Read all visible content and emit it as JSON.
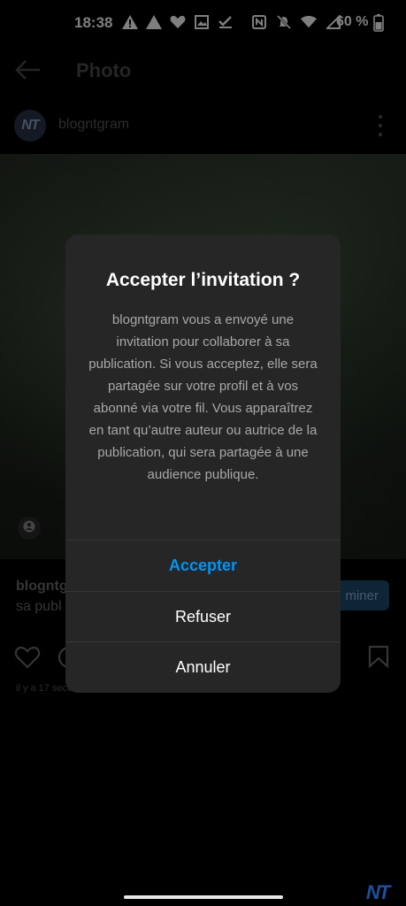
{
  "status_bar": {
    "time": "18:38",
    "left_icons": [
      "warning-icon",
      "warning-triangle-icon",
      "heart-icon",
      "image-icon",
      "check-icon"
    ],
    "right_icons": [
      "nfc-icon",
      "mute-icon",
      "wifi-icon",
      "signal-icon"
    ],
    "battery_percent": "60 %"
  },
  "header": {
    "title": "Photo",
    "back_icon": "arrow-left-icon"
  },
  "post": {
    "avatar_text": "NT",
    "username": "blogntgram",
    "caption_user": "blogntgram",
    "caption_text": "sa publ",
    "cta_label": "miner",
    "time_ago": "il y a 17 seco"
  },
  "dialog": {
    "title": "Accepter l’invitation ?",
    "body": "blogntgram vous a envoyé une invitation pour collaborer à sa publication. Si vous acceptez, elle sera partagée sur votre profil et à vos abonné via votre fil. Vous apparaîtrez en tant qu’autre auteur ou autrice de la publication, qui sera partagée à une audience publique.",
    "accept_label": "Accepter",
    "refuse_label": "Refuser",
    "cancel_label": "Annuler"
  },
  "watermark": "NT",
  "colors": {
    "accent": "#0095f6",
    "dialog_bg": "#262626",
    "background": "#000000"
  }
}
